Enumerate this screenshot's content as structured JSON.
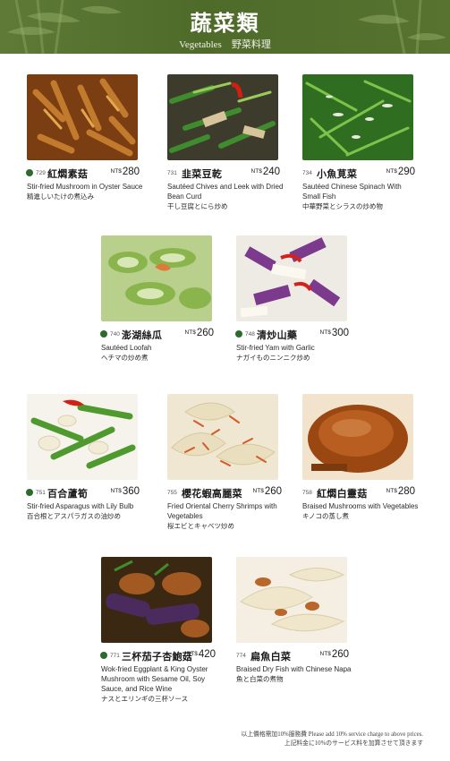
{
  "header": {
    "title_zh": "蔬菜類",
    "subtitle": "Vegetables　野菜料理"
  },
  "currency": "NT$",
  "items": [
    {
      "code": "729",
      "name_zh": "紅燜素菇",
      "price": "280",
      "name_en": "Stir-fried Mushroom in Oyster Sauce",
      "name_ja": "精進しいたけの煮込み"
    },
    {
      "code": "731",
      "name_zh": "韭菜豆乾",
      "price": "240",
      "name_en": "Sautéed Chives and Leek with Dried Bean Curd",
      "name_ja": "干し豆腐とにら炒め"
    },
    {
      "code": "734",
      "name_zh": "小魚莧菜",
      "price": "290",
      "name_en": "Sautéed Chinese Spinach With Small Fish",
      "name_ja": "中華野菜とシラスの炒め物"
    },
    {
      "code": "740",
      "name_zh": "澎湖絲瓜",
      "price": "260",
      "name_en": "Sautéed Loofah",
      "name_ja": "ヘチマの炒め煮"
    },
    {
      "code": "748",
      "name_zh": "清炒山藥",
      "price": "300",
      "name_en": "Stir-fried Yam with Garlic",
      "name_ja": "ナガイものニンニク炒め"
    },
    {
      "code": "751",
      "name_zh": "百合蘆筍",
      "price": "360",
      "name_en": "Stir-fried Asparagus with Lily Bulb",
      "name_ja": "百合根とアスパラガスの油炒め"
    },
    {
      "code": "755",
      "name_zh": "櫻花蝦高麗菜",
      "price": "260",
      "name_en": "Fried Oriental Cherry Shrimps with Vegetables",
      "name_ja": "桜エビとキャベツ炒め"
    },
    {
      "code": "758",
      "name_zh": "紅燜白靈菇",
      "price": "280",
      "name_en": "Braised Mushrooms with Vegetables",
      "name_ja": "キノコの蒸し煮"
    },
    {
      "code": "771",
      "name_zh": "三杯茄子杏鮑菇",
      "price": "420",
      "name_en": "Wok-fried Eggplant & King Oyster Mushroom with Sesame Oil, Soy Sauce, and Rice Wine",
      "name_ja": "ナスとエリンギの三杯ソース"
    },
    {
      "code": "774",
      "name_zh": "扁魚白菜",
      "price": "260",
      "name_en": "Braised Dry Fish with Chinese Napa",
      "name_ja": "魚と白菜の煮物"
    }
  ],
  "footer": {
    "line1": "以上價格需加10%服務費 Please add 10% service charge to above prices.",
    "line2": "上記料金に10%のサービス料を加算させて頂きます"
  },
  "colors": {
    "header_green": "#567230",
    "dot_green": "#2d6a2e"
  }
}
